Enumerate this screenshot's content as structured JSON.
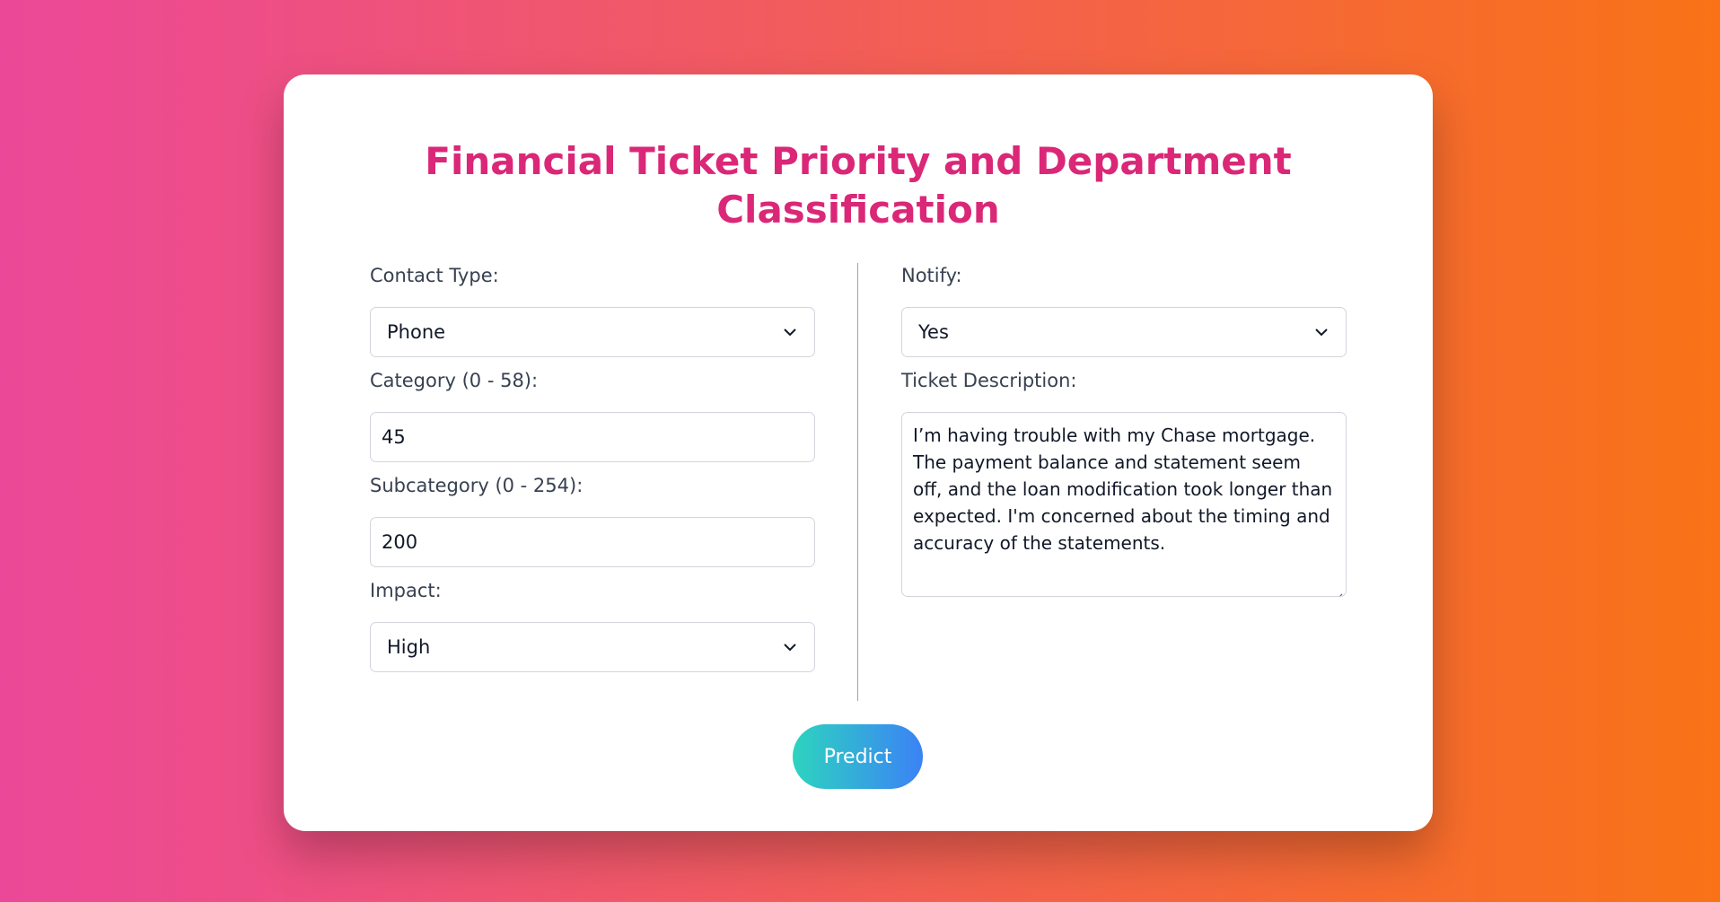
{
  "page": {
    "title": "Financial Ticket Priority and Department Classification"
  },
  "form": {
    "contact_type": {
      "label": "Contact Type:",
      "value": "Phone"
    },
    "category": {
      "label": "Category (0 - 58):",
      "value": "45"
    },
    "subcategory": {
      "label": "Subcategory (0 - 254):",
      "value": "200"
    },
    "impact": {
      "label": "Impact:",
      "value": "High"
    },
    "notify": {
      "label": "Notify:",
      "value": "Yes"
    },
    "description": {
      "label": "Ticket Description:",
      "value": "I’m having trouble with my Chase mortgage. The payment balance and statement seem off, and the loan modification took longer than expected. I'm concerned about the timing and accuracy of the statements."
    }
  },
  "actions": {
    "predict_label": "Predict"
  },
  "colors": {
    "background_start": "#ec4899",
    "background_end": "#f97316",
    "title": "#db2777",
    "button_start": "#2dd4bf",
    "button_end": "#3b82f6"
  },
  "icons": {
    "select_arrow": "chevron-down-icon",
    "textarea_resize": "resize-handle-icon"
  }
}
